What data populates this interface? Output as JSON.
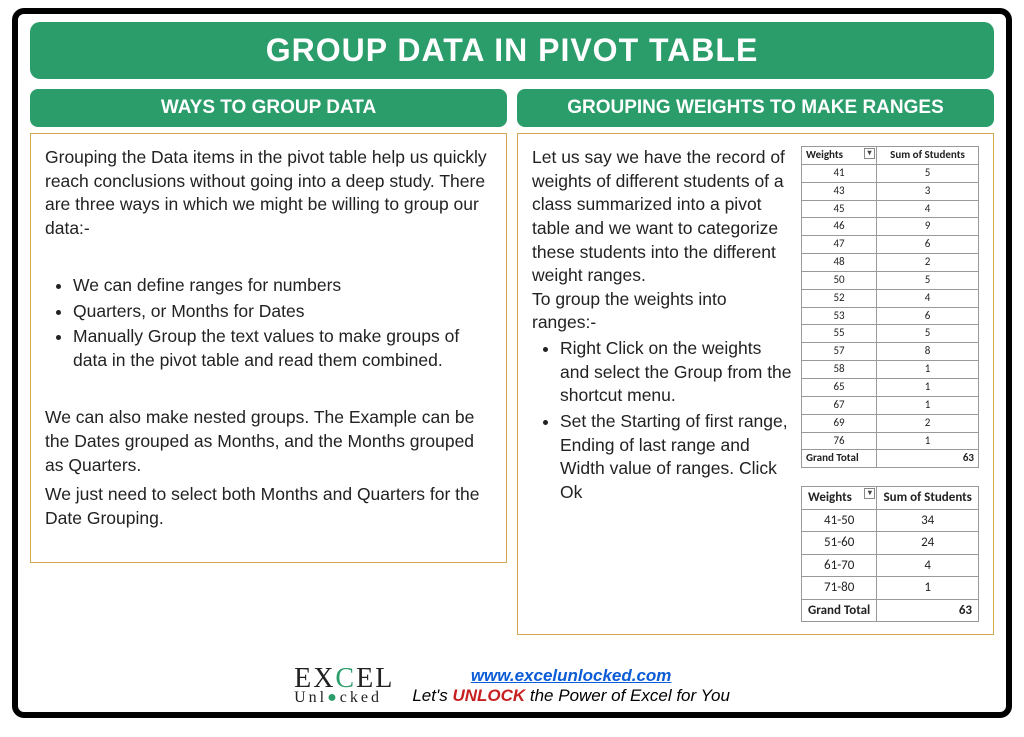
{
  "title": "GROUP DATA IN PIVOT TABLE",
  "left": {
    "heading": "WAYS TO GROUP DATA",
    "intro": "Grouping the Data items in the pivot table help us quickly reach conclusions without going into a deep study. There are three ways in which we might be willing to group our data:-",
    "bullets": [
      "We can define ranges for numbers",
      "Quarters, or Months for Dates",
      "Manually Group the text values to make groups of data in the pivot table and read them combined."
    ],
    "para2": "We can also make nested groups. The Example can be the Dates grouped as Months, and the Months grouped as Quarters.",
    "para3": "We just need to select both Months and Quarters for the Date Grouping."
  },
  "right": {
    "heading": "GROUPING WEIGHTS TO MAKE RANGES",
    "intro": "Let us say we have the record of weights of different students of a class summarized into a pivot table and we want to categorize these students into the different weight ranges.",
    "lead": "To group the weights into ranges:-",
    "steps": [
      "Right Click on the weights and select the Group from the shortcut menu.",
      "Set the Starting of first range, Ending of last range and Width value of ranges. Click Ok"
    ]
  },
  "table1": {
    "h1": "Weights",
    "h2": "Sum of Students",
    "rows": [
      [
        "41",
        "5"
      ],
      [
        "43",
        "3"
      ],
      [
        "45",
        "4"
      ],
      [
        "46",
        "9"
      ],
      [
        "47",
        "6"
      ],
      [
        "48",
        "2"
      ],
      [
        "50",
        "5"
      ],
      [
        "52",
        "4"
      ],
      [
        "53",
        "6"
      ],
      [
        "55",
        "5"
      ],
      [
        "57",
        "8"
      ],
      [
        "58",
        "1"
      ],
      [
        "65",
        "1"
      ],
      [
        "67",
        "1"
      ],
      [
        "69",
        "2"
      ],
      [
        "76",
        "1"
      ]
    ],
    "gt_label": "Grand Total",
    "gt_value": "63"
  },
  "table2": {
    "h1": "Weights",
    "h2": "Sum of Students",
    "rows": [
      [
        "41-50",
        "34"
      ],
      [
        "51-60",
        "24"
      ],
      [
        "61-70",
        "4"
      ],
      [
        "71-80",
        "1"
      ]
    ],
    "gt_label": "Grand Total",
    "gt_value": "63"
  },
  "footer": {
    "url": "www.excelunlocked.com",
    "tag_pre": "Let's ",
    "tag_unlock": "UNLOCK",
    "tag_post": " the Power of Excel for You"
  },
  "chart_data": [
    {
      "type": "table",
      "title": "Weights vs Sum of Students (raw)",
      "columns": [
        "Weights",
        "Sum of Students"
      ],
      "rows": [
        [
          41,
          5
        ],
        [
          43,
          3
        ],
        [
          45,
          4
        ],
        [
          46,
          9
        ],
        [
          47,
          6
        ],
        [
          48,
          2
        ],
        [
          50,
          5
        ],
        [
          52,
          4
        ],
        [
          53,
          6
        ],
        [
          55,
          5
        ],
        [
          57,
          8
        ],
        [
          58,
          1
        ],
        [
          65,
          1
        ],
        [
          67,
          1
        ],
        [
          69,
          2
        ],
        [
          76,
          1
        ]
      ],
      "grand_total": 63
    },
    {
      "type": "table",
      "title": "Weights grouped into ranges",
      "columns": [
        "Weights",
        "Sum of Students"
      ],
      "rows": [
        [
          "41-50",
          34
        ],
        [
          "51-60",
          24
        ],
        [
          "61-70",
          4
        ],
        [
          "71-80",
          1
        ]
      ],
      "grand_total": 63
    }
  ]
}
